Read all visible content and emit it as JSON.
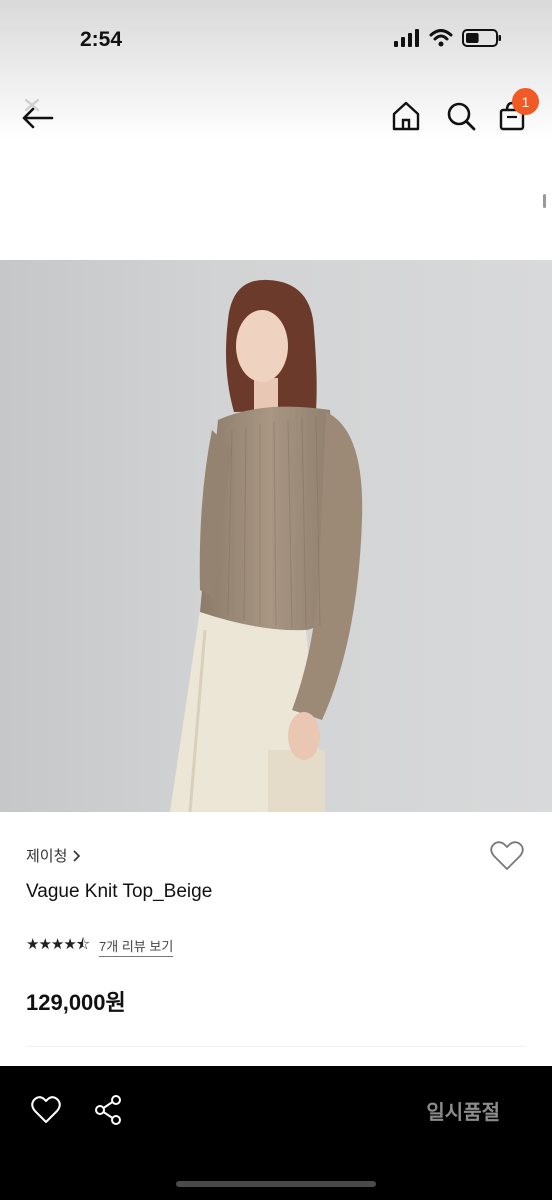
{
  "status_bar": {
    "time": "2:54",
    "icons": [
      "signal-icon",
      "wifi-icon",
      "battery-icon"
    ],
    "battery_level": 0.45
  },
  "top_nav": {
    "icons": [
      "back-arrow-icon",
      "home-icon",
      "search-icon",
      "cart-icon"
    ],
    "cart_count": "1",
    "badge_color": "#f15a24"
  },
  "product": {
    "brand": "제이청",
    "name": "Vague Knit Top_Beige",
    "rating_value": 4.5,
    "rating_max": 5,
    "review_link": "7개 리뷰 보기",
    "price": "129,000원"
  },
  "bottom_bar": {
    "icons": [
      "heart-outline-icon",
      "share-icon"
    ],
    "action_label": "일시품절"
  }
}
